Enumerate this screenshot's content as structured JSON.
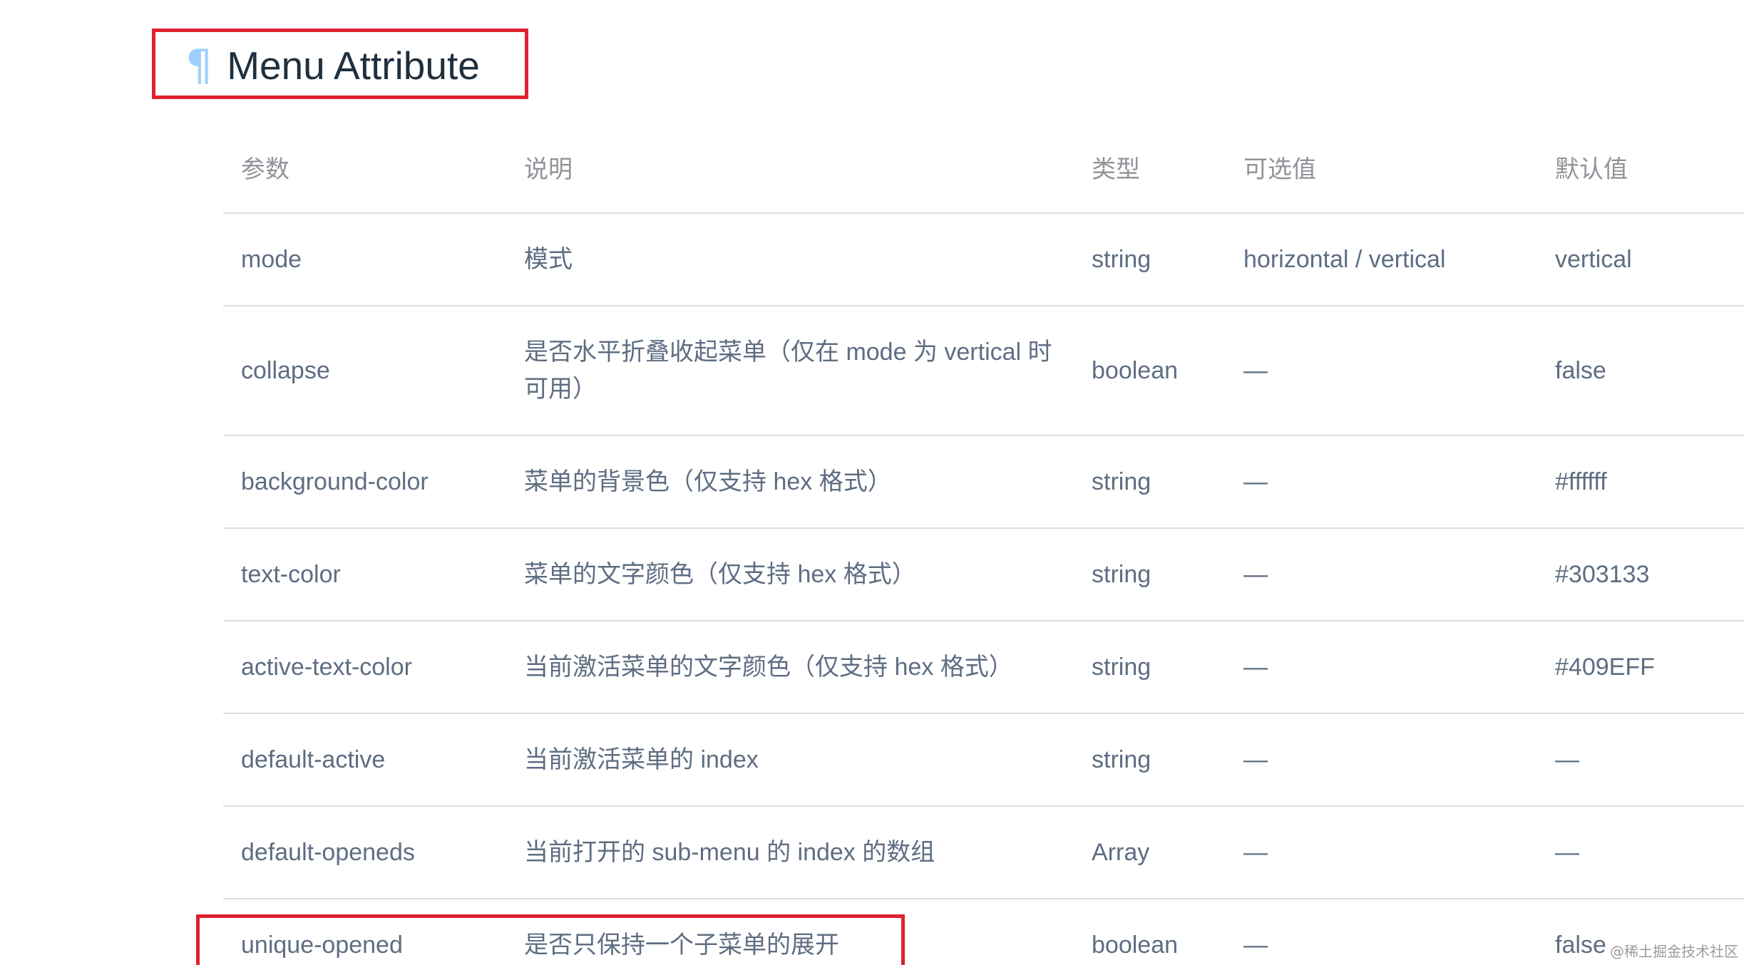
{
  "section": {
    "anchor_symbol": "¶",
    "title": "Menu Attribute"
  },
  "table": {
    "headers": {
      "param": "参数",
      "desc": "说明",
      "type": "类型",
      "options": "可选值",
      "default": "默认值"
    },
    "rows": [
      {
        "param": "mode",
        "desc": "模式",
        "type": "string",
        "options": "horizontal / vertical",
        "default": "vertical"
      },
      {
        "param": "collapse",
        "desc": "是否水平折叠收起菜单（仅在 mode 为 vertical 时可用）",
        "type": "boolean",
        "options": "—",
        "default": "false"
      },
      {
        "param": "background-color",
        "desc": "菜单的背景色（仅支持 hex 格式）",
        "type": "string",
        "options": "—",
        "default": "#ffffff"
      },
      {
        "param": "text-color",
        "desc": "菜单的文字颜色（仅支持 hex 格式）",
        "type": "string",
        "options": "—",
        "default": "#303133"
      },
      {
        "param": "active-text-color",
        "desc": "当前激活菜单的文字颜色（仅支持 hex 格式）",
        "type": "string",
        "options": "—",
        "default": "#409EFF"
      },
      {
        "param": "default-active",
        "desc": "当前激活菜单的 index",
        "type": "string",
        "options": "—",
        "default": "—"
      },
      {
        "param": "default-openeds",
        "desc": "当前打开的 sub-menu 的 index 的数组",
        "type": "Array",
        "options": "—",
        "default": "—"
      },
      {
        "param": "unique-opened",
        "desc": "是否只保持一个子菜单的展开",
        "type": "boolean",
        "options": "—",
        "default": "false"
      }
    ]
  },
  "watermark": "@稀土掘金技术社区",
  "colors": {
    "annotation_box": "#e0212e",
    "anchor": "#a0cfff",
    "heading_text": "#1f2f3d",
    "cell_text": "#5e6d82",
    "header_text": "#909399",
    "divider": "#dcdfe6"
  }
}
